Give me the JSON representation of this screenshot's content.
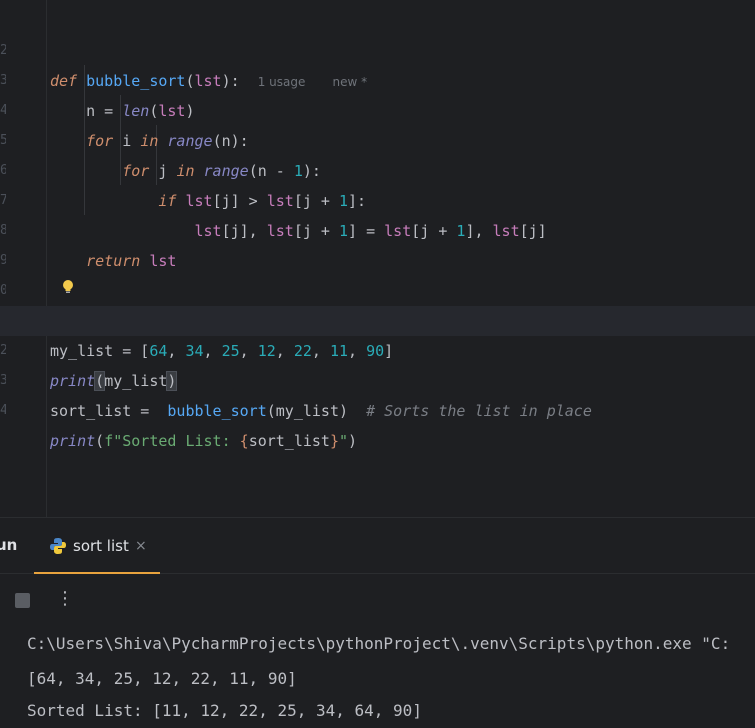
{
  "editor": {
    "hint_usage": "1 usage",
    "hint_new": "new *",
    "line_numbers": [
      "2",
      "3",
      "4",
      "5",
      "6",
      "7",
      "8",
      "9",
      "0",
      "1",
      "2",
      "3",
      "4"
    ]
  },
  "run_panel": {
    "title": "un",
    "tab_label": "sort list",
    "close_glyph": "×",
    "more_glyph": "⋮",
    "console": [
      "C:\\Users\\Shiva\\PycharmProjects\\pythonProject\\.venv\\Scripts\\python.exe \"C:",
      "[64, 34, 25, 12, 22, 11, 90]",
      "Sorted List: [11, 12, 22, 25, 34, 64, 90]"
    ]
  },
  "colors": {
    "keyword": "#cf8e6d",
    "function": "#56a8f5",
    "builtin": "#8888c6",
    "number": "#2aacb8",
    "string": "#6aab73",
    "comment": "#7a7e85",
    "param": "#c77dbb",
    "tab_underline": "#e8a33e"
  },
  "icons": [
    "lightbulb-icon",
    "python-icon",
    "close-icon",
    "stop-icon",
    "more-vertical-icon"
  ]
}
